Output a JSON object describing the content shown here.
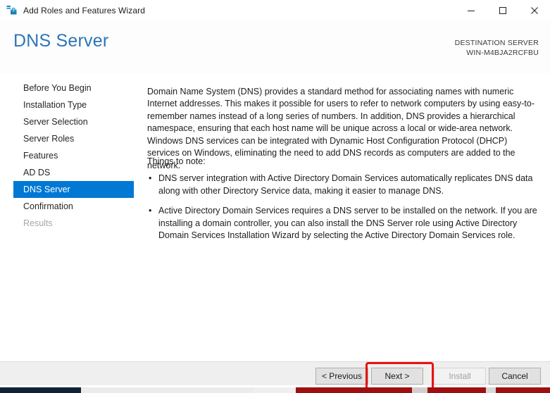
{
  "window": {
    "title": "Add Roles and Features Wizard",
    "icon": "toolbox-icon",
    "controls": {
      "minimize": "minimize-icon",
      "maximize": "maximize-icon",
      "close": "close-icon"
    }
  },
  "header": {
    "page_title": "DNS Server",
    "destination_label": "DESTINATION SERVER",
    "destination_name": "WIN-M4BJA2RCFBU",
    "title_color": "#2e75b6"
  },
  "sidebar": {
    "selected_index": 6,
    "selected_color": "#0078d4",
    "items": [
      {
        "label": "Before You Begin",
        "state": "normal"
      },
      {
        "label": "Installation Type",
        "state": "normal"
      },
      {
        "label": "Server Selection",
        "state": "normal"
      },
      {
        "label": "Server Roles",
        "state": "normal"
      },
      {
        "label": "Features",
        "state": "normal"
      },
      {
        "label": "AD DS",
        "state": "normal"
      },
      {
        "label": "DNS Server",
        "state": "selected"
      },
      {
        "label": "Confirmation",
        "state": "normal"
      },
      {
        "label": "Results",
        "state": "disabled"
      }
    ]
  },
  "content": {
    "intro": "Domain Name System (DNS) provides a standard method for associating names with numeric Internet addresses. This makes it possible for users to refer to network computers by using easy-to-remember names instead of a long series of numbers. In addition, DNS provides a hierarchical namespace, ensuring that each host name will be unique across a local or wide-area network. Windows DNS services can be integrated with Dynamic Host Configuration Protocol (DHCP) services on Windows, eliminating the need to add DNS records as computers are added to the network.",
    "things_to_note_label": "Things to note:",
    "bullet_glyph": "•",
    "notes": [
      "DNS server integration with Active Directory Domain Services automatically replicates DNS data along with other Directory Service data, making it easier to manage DNS.",
      "Active Directory Domain Services requires a DNS server to be installed on the network. If you are installing a domain controller, you can also install the DNS Server role using Active Directory Domain Services Installation Wizard by selecting the Active Directory Domain Services role."
    ]
  },
  "footer": {
    "previous_label": "< Previous",
    "next_label": "Next >",
    "install_label": "Install",
    "cancel_label": "Cancel",
    "install_disabled": true,
    "highlight_color": "#e8140f",
    "highlighted_button": "Next >"
  }
}
